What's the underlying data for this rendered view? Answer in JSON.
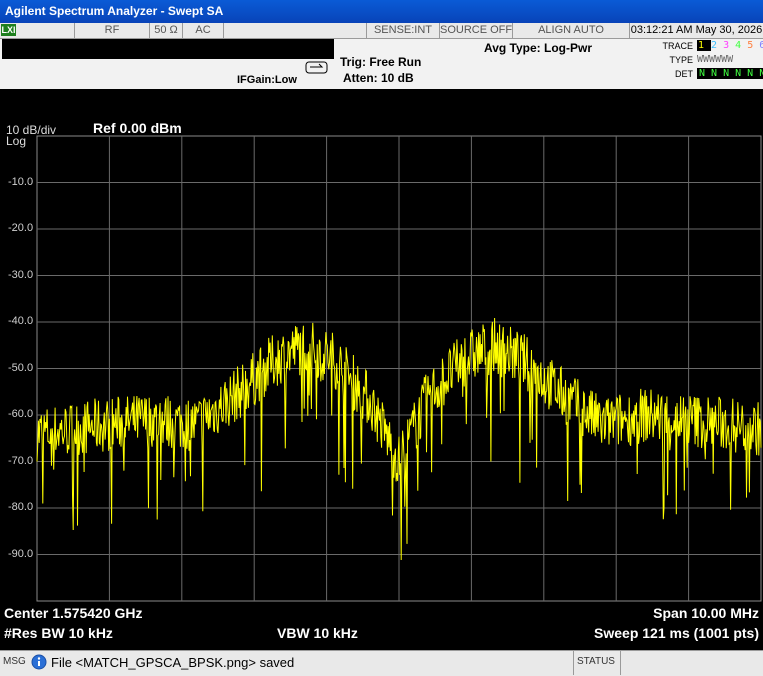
{
  "window": {
    "title": "Agilent Spectrum Analyzer - Swept SA"
  },
  "status_row": {
    "logo": "LXI",
    "input": "RF",
    "impedance": "50 Ω",
    "coupling": "AC",
    "sense": "SENSE:INT",
    "source": "SOURCE OFF",
    "align": "ALIGN AUTO",
    "time": "03:12:21 AM",
    "date": "May 30, 2026"
  },
  "settings": {
    "avg_type": "Avg Type: Log-Pwr",
    "trig": "Trig: Free Run",
    "atten": "Atten: 10 dB",
    "ifgain": "IFGain:Low"
  },
  "trace_panel": {
    "trace_label": "TRACE",
    "type_label": "TYPE",
    "det_label": "DET",
    "traces": [
      "1",
      "2",
      "3",
      "4",
      "5",
      "6"
    ],
    "trace_colors": [
      "#ffff00",
      "#40c0ff",
      "#ff40ff",
      "#40ff40",
      "#ff8040",
      "#8080ff"
    ],
    "type_values": "WWWWWW",
    "det_values": "N N N N N N"
  },
  "display": {
    "scale": "10 dB/div",
    "ref": "Ref 0.00 dBm",
    "log": "Log",
    "y_labels": [
      "-10.0",
      "-20.0",
      "-30.0",
      "-40.0",
      "-50.0",
      "-60.0",
      "-70.0",
      "-80.0",
      "-90.0"
    ]
  },
  "footer": {
    "center": "Center 1.575420 GHz",
    "res_bw": "#Res BW 10 kHz",
    "vbw": "VBW 10 kHz",
    "span": "Span 10.00 MHz",
    "sweep": "Sweep  121 ms (1001 pts)"
  },
  "msg": {
    "tag": "MSG",
    "text": "File <MATCH_GPSCA_BPSK.png> saved",
    "status_tag": "STATUS"
  },
  "chart_data": {
    "type": "line",
    "x_range_mhz": [
      1570.42,
      1580.42
    ],
    "ylim": [
      -100,
      0
    ],
    "y_unit": "dBm",
    "grid": true,
    "trace_color": "#ffff00",
    "envelope": [
      {
        "x": 1570.42,
        "y": -64
      },
      {
        "x": 1571.42,
        "y": -62
      },
      {
        "x": 1572.02,
        "y": -61
      },
      {
        "x": 1572.62,
        "y": -62
      },
      {
        "x": 1573.22,
        "y": -55
      },
      {
        "x": 1573.72,
        "y": -48
      },
      {
        "x": 1574.12,
        "y": -45
      },
      {
        "x": 1574.52,
        "y": -48
      },
      {
        "x": 1575.02,
        "y": -57
      },
      {
        "x": 1575.42,
        "y": -70
      },
      {
        "x": 1575.82,
        "y": -56
      },
      {
        "x": 1576.32,
        "y": -48
      },
      {
        "x": 1576.72,
        "y": -45
      },
      {
        "x": 1577.12,
        "y": -48
      },
      {
        "x": 1577.62,
        "y": -55
      },
      {
        "x": 1578.22,
        "y": -62
      },
      {
        "x": 1578.82,
        "y": -60
      },
      {
        "x": 1579.42,
        "y": -61
      },
      {
        "x": 1580.42,
        "y": -63
      }
    ]
  }
}
